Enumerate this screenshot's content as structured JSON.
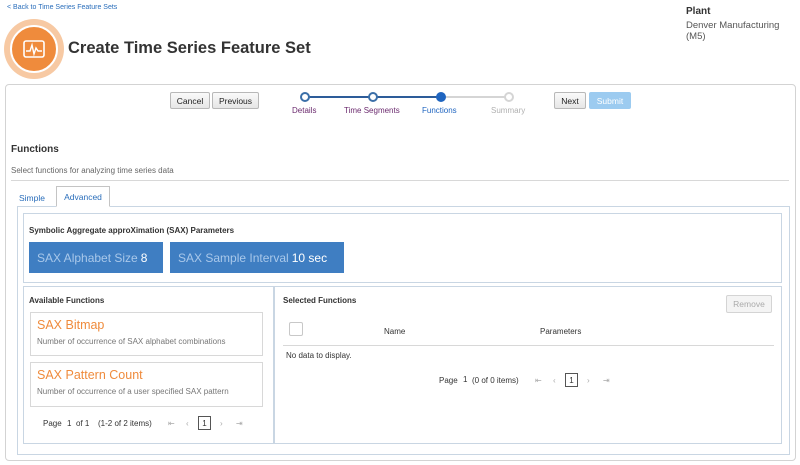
{
  "header": {
    "back_link": "< Back to Time Series Feature Sets",
    "title": "Create Time Series Feature Set",
    "plant_label": "Plant",
    "plant_value": "Denver Manufacturing (M5)"
  },
  "toolbar": {
    "cancel_label": "Cancel",
    "previous_label": "Previous",
    "next_label": "Next",
    "submit_label": "Submit"
  },
  "wizard": {
    "steps": [
      {
        "label": "Details",
        "state": "done"
      },
      {
        "label": "Time Segments",
        "state": "done"
      },
      {
        "label": "Functions",
        "state": "current"
      },
      {
        "label": "Summary",
        "state": "future"
      }
    ]
  },
  "section": {
    "title": "Functions",
    "description": "Select functions for analyzing time series data"
  },
  "tabs": [
    {
      "label": "Simple",
      "active": false
    },
    {
      "label": "Advanced",
      "active": true
    }
  ],
  "sax": {
    "title": "Symbolic Aggregate approXimation (SAX) Parameters",
    "alphabet_label": "SAX Alphabet Size",
    "alphabet_value": "8",
    "interval_label": "SAX Sample Interval",
    "interval_value": "10 sec"
  },
  "available": {
    "title": "Available Functions",
    "items": [
      {
        "name": "SAX Bitmap",
        "description": "Number of occurrence of SAX alphabet combinations"
      },
      {
        "name": "SAX Pattern Count",
        "description": "Number of occurrence of a user specified SAX pattern"
      }
    ],
    "pager": {
      "page_label": "Page",
      "page_value": "1",
      "of_label": "of 1",
      "items_label": "(1-2 of 2 items)",
      "current_page": "1"
    }
  },
  "selected": {
    "title": "Selected Functions",
    "remove_label": "Remove",
    "columns": [
      "Name",
      "Parameters"
    ],
    "empty_text": "No data to display.",
    "pager": {
      "page_label": "Page",
      "page_value": "1",
      "items_label": "(0 of 0 items)",
      "current_page": "1"
    }
  },
  "colors": {
    "accent_orange": "#ef8b3c",
    "sax_blue": "#3f7ec2",
    "link_blue": "#2a6ebb",
    "step_done_text": "#6b2a6e",
    "step_current_text": "#1f65c0"
  }
}
